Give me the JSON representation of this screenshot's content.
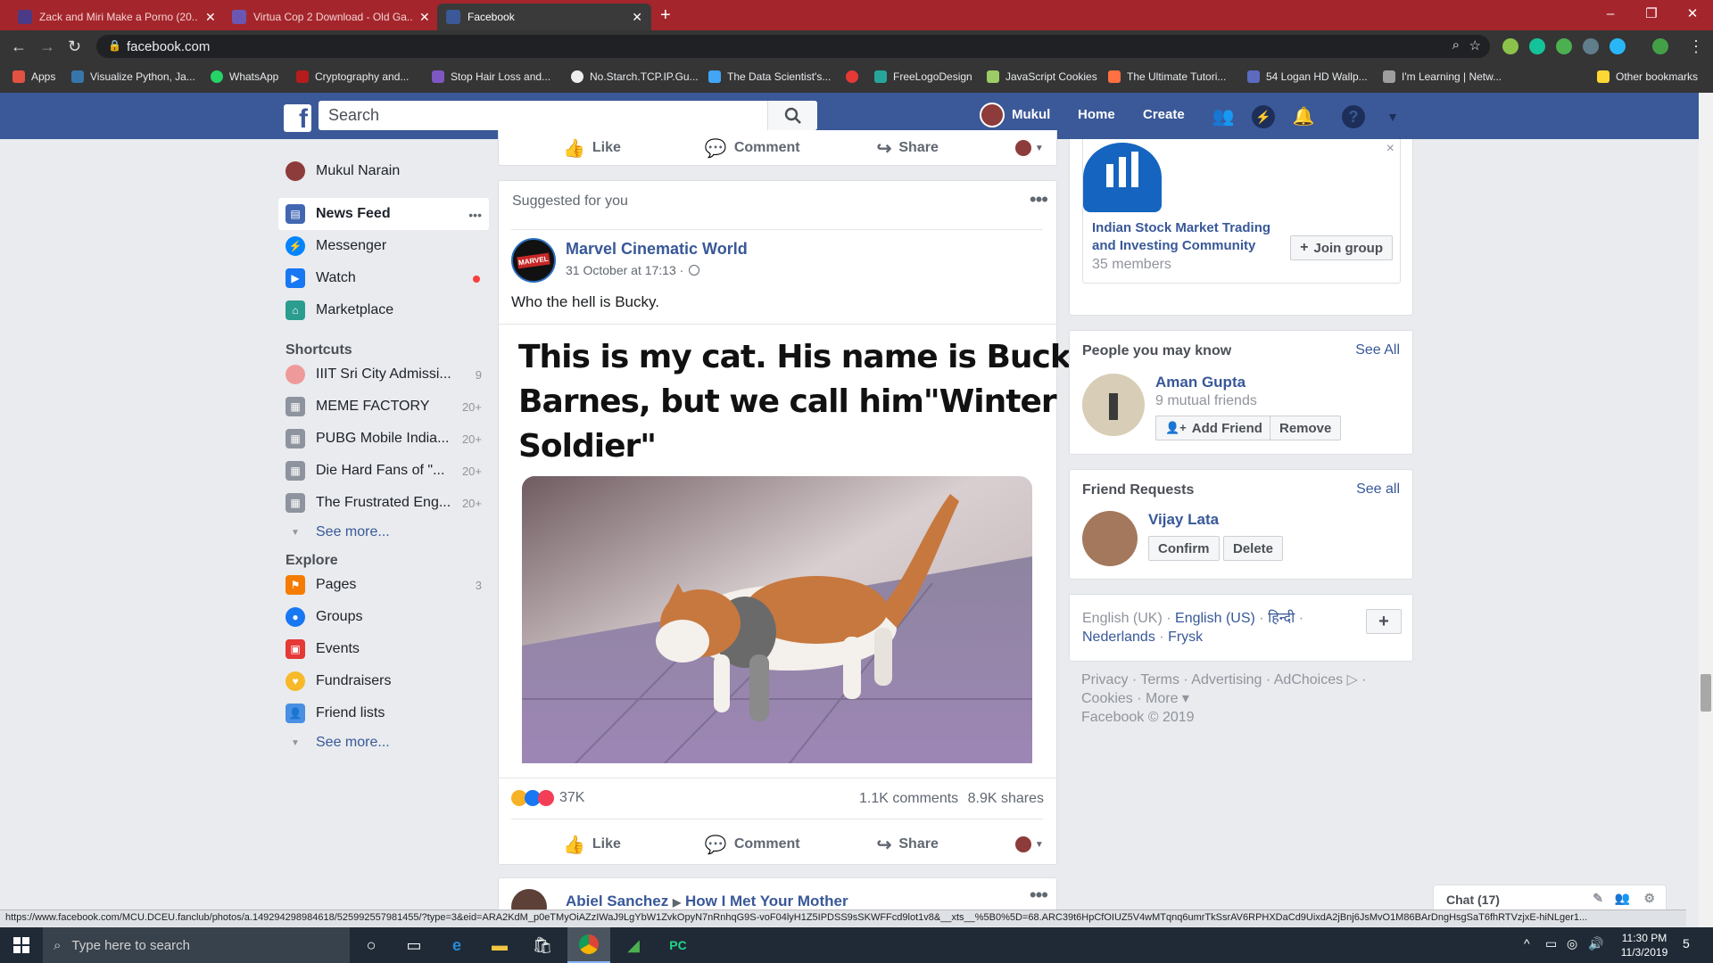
{
  "browser": {
    "tabs": [
      {
        "title": "Zack and Miri Make a Porno (20...",
        "color": "#4b3a86"
      },
      {
        "title": "Virtua Cop 2 Download - Old Ga...",
        "color": "#6b57b2"
      },
      {
        "title": "Facebook",
        "color": "#3b5998"
      }
    ],
    "new_tab": "+",
    "url": "facebook.com",
    "window_controls": [
      "–",
      "❐",
      "✕"
    ],
    "bookmarks": [
      "Apps",
      "Visualize Python, Ja...",
      "WhatsApp",
      "Cryptography and...",
      "Stop Hair Loss and...",
      "No.Starch.TCP.IP.Gu...",
      "The Data Scientist's...",
      "",
      "FreeLogoDesign",
      "JavaScript Cookies",
      "The Ultimate Tutori...",
      "54 Logan HD Wallp...",
      "I'm Learning | Netw..."
    ],
    "other_bookmarks": "Other bookmarks"
  },
  "header": {
    "logo": "f",
    "search_placeholder": "Search",
    "user_name": "Mukul",
    "home": "Home",
    "create": "Create"
  },
  "left_nav": {
    "profile_name": "Mukul Narain",
    "items": [
      {
        "label": "News Feed",
        "more": "•••"
      },
      {
        "label": "Messenger"
      },
      {
        "label": "Watch"
      },
      {
        "label": "Marketplace"
      }
    ],
    "shortcuts_heading": "Shortcuts",
    "shortcuts": [
      {
        "label": "IIIT Sri City Admissi...",
        "count": "9"
      },
      {
        "label": "MEME FACTORY",
        "count": "20+"
      },
      {
        "label": "PUBG Mobile India...",
        "count": "20+"
      },
      {
        "label": "Die Hard Fans of \"...",
        "count": "20+"
      },
      {
        "label": "The Frustrated Eng...",
        "count": "20+"
      }
    ],
    "see_more": "See more...",
    "explore_heading": "Explore",
    "explore": [
      {
        "label": "Pages",
        "count": "3"
      },
      {
        "label": "Groups",
        "count": ""
      },
      {
        "label": "Events",
        "count": ""
      },
      {
        "label": "Fundraisers",
        "count": ""
      },
      {
        "label": "Friend lists",
        "count": ""
      }
    ],
    "see_more_2": "See more..."
  },
  "feed": {
    "top_actions": {
      "like": "Like",
      "comment": "Comment",
      "share": "Share"
    },
    "post": {
      "suggested": "Suggested for you",
      "page_name": "Marvel Cinematic World",
      "avatar_text": "MARVEL",
      "timestamp": "31 October at 17:13 ·",
      "text": "Who the hell is Bucky.",
      "meme_caption_line1": "This is my cat. His name is Bucky",
      "meme_caption_line2": "Barnes, but we call him\"Winter",
      "meme_caption_line3": "Soldier\"",
      "reactions_count": "37K",
      "comments": "1.1K comments",
      "shares": "8.9K shares",
      "like": "Like",
      "comment": "Comment",
      "share": "Share"
    },
    "next_post": {
      "author": "Abiel Sanchez",
      "target": "How I Met Your Mother"
    }
  },
  "right": {
    "group": {
      "name_line1": "Indian Stock Market Trading",
      "name_line2": "and Investing Community",
      "members": "35 members",
      "join": "Join group",
      "close": "×"
    },
    "pymk": {
      "title": "People you may know",
      "see_all": "See All",
      "name": "Aman Gupta",
      "mutual": "9 mutual friends",
      "add": "Add Friend",
      "remove": "Remove"
    },
    "requests": {
      "title": "Friend Requests",
      "see_all": "See all",
      "name": "Vijay Lata",
      "confirm": "Confirm",
      "delete": "Delete"
    },
    "languages": {
      "current": "English (UK) ·",
      "l1": "English (US)",
      "l2": "हिन्दी",
      "sep": "·",
      "l3": "Nederlands",
      "l4": "Frysk",
      "add": "+"
    },
    "footer": {
      "line1": "Privacy · Terms · Advertising · AdChoices ▷ ·",
      "line2": "Cookies · More ▾",
      "copyright": "Facebook © 2019"
    },
    "chat": "Chat (17)"
  },
  "status_url": "https://www.facebook.com/MCU.DCEU.fanclub/photos/a.149294298984618/525992557981455/?type=3&eid=ARA2KdM_p0eTMyOiAZzIWaJ9LgYbW1ZvkOpyN7nRnhqG9S-voF04lyH1Z5IPDSS9sSKWFFcd9lot1v8&__xts__%5B0%5D=68.ARC39t6HpCfOIUZ5V4wMTqnq6umrTkSsrAV6RPHXDaCd9UixdA2jBnj6JsMvO1M86BArDngHsgSaT6fhRTVzjxE-hiNLger1...",
  "taskbar": {
    "search_placeholder": "Type here to search",
    "time": "11:30 PM",
    "date": "11/3/2019",
    "notif_count": "5"
  }
}
